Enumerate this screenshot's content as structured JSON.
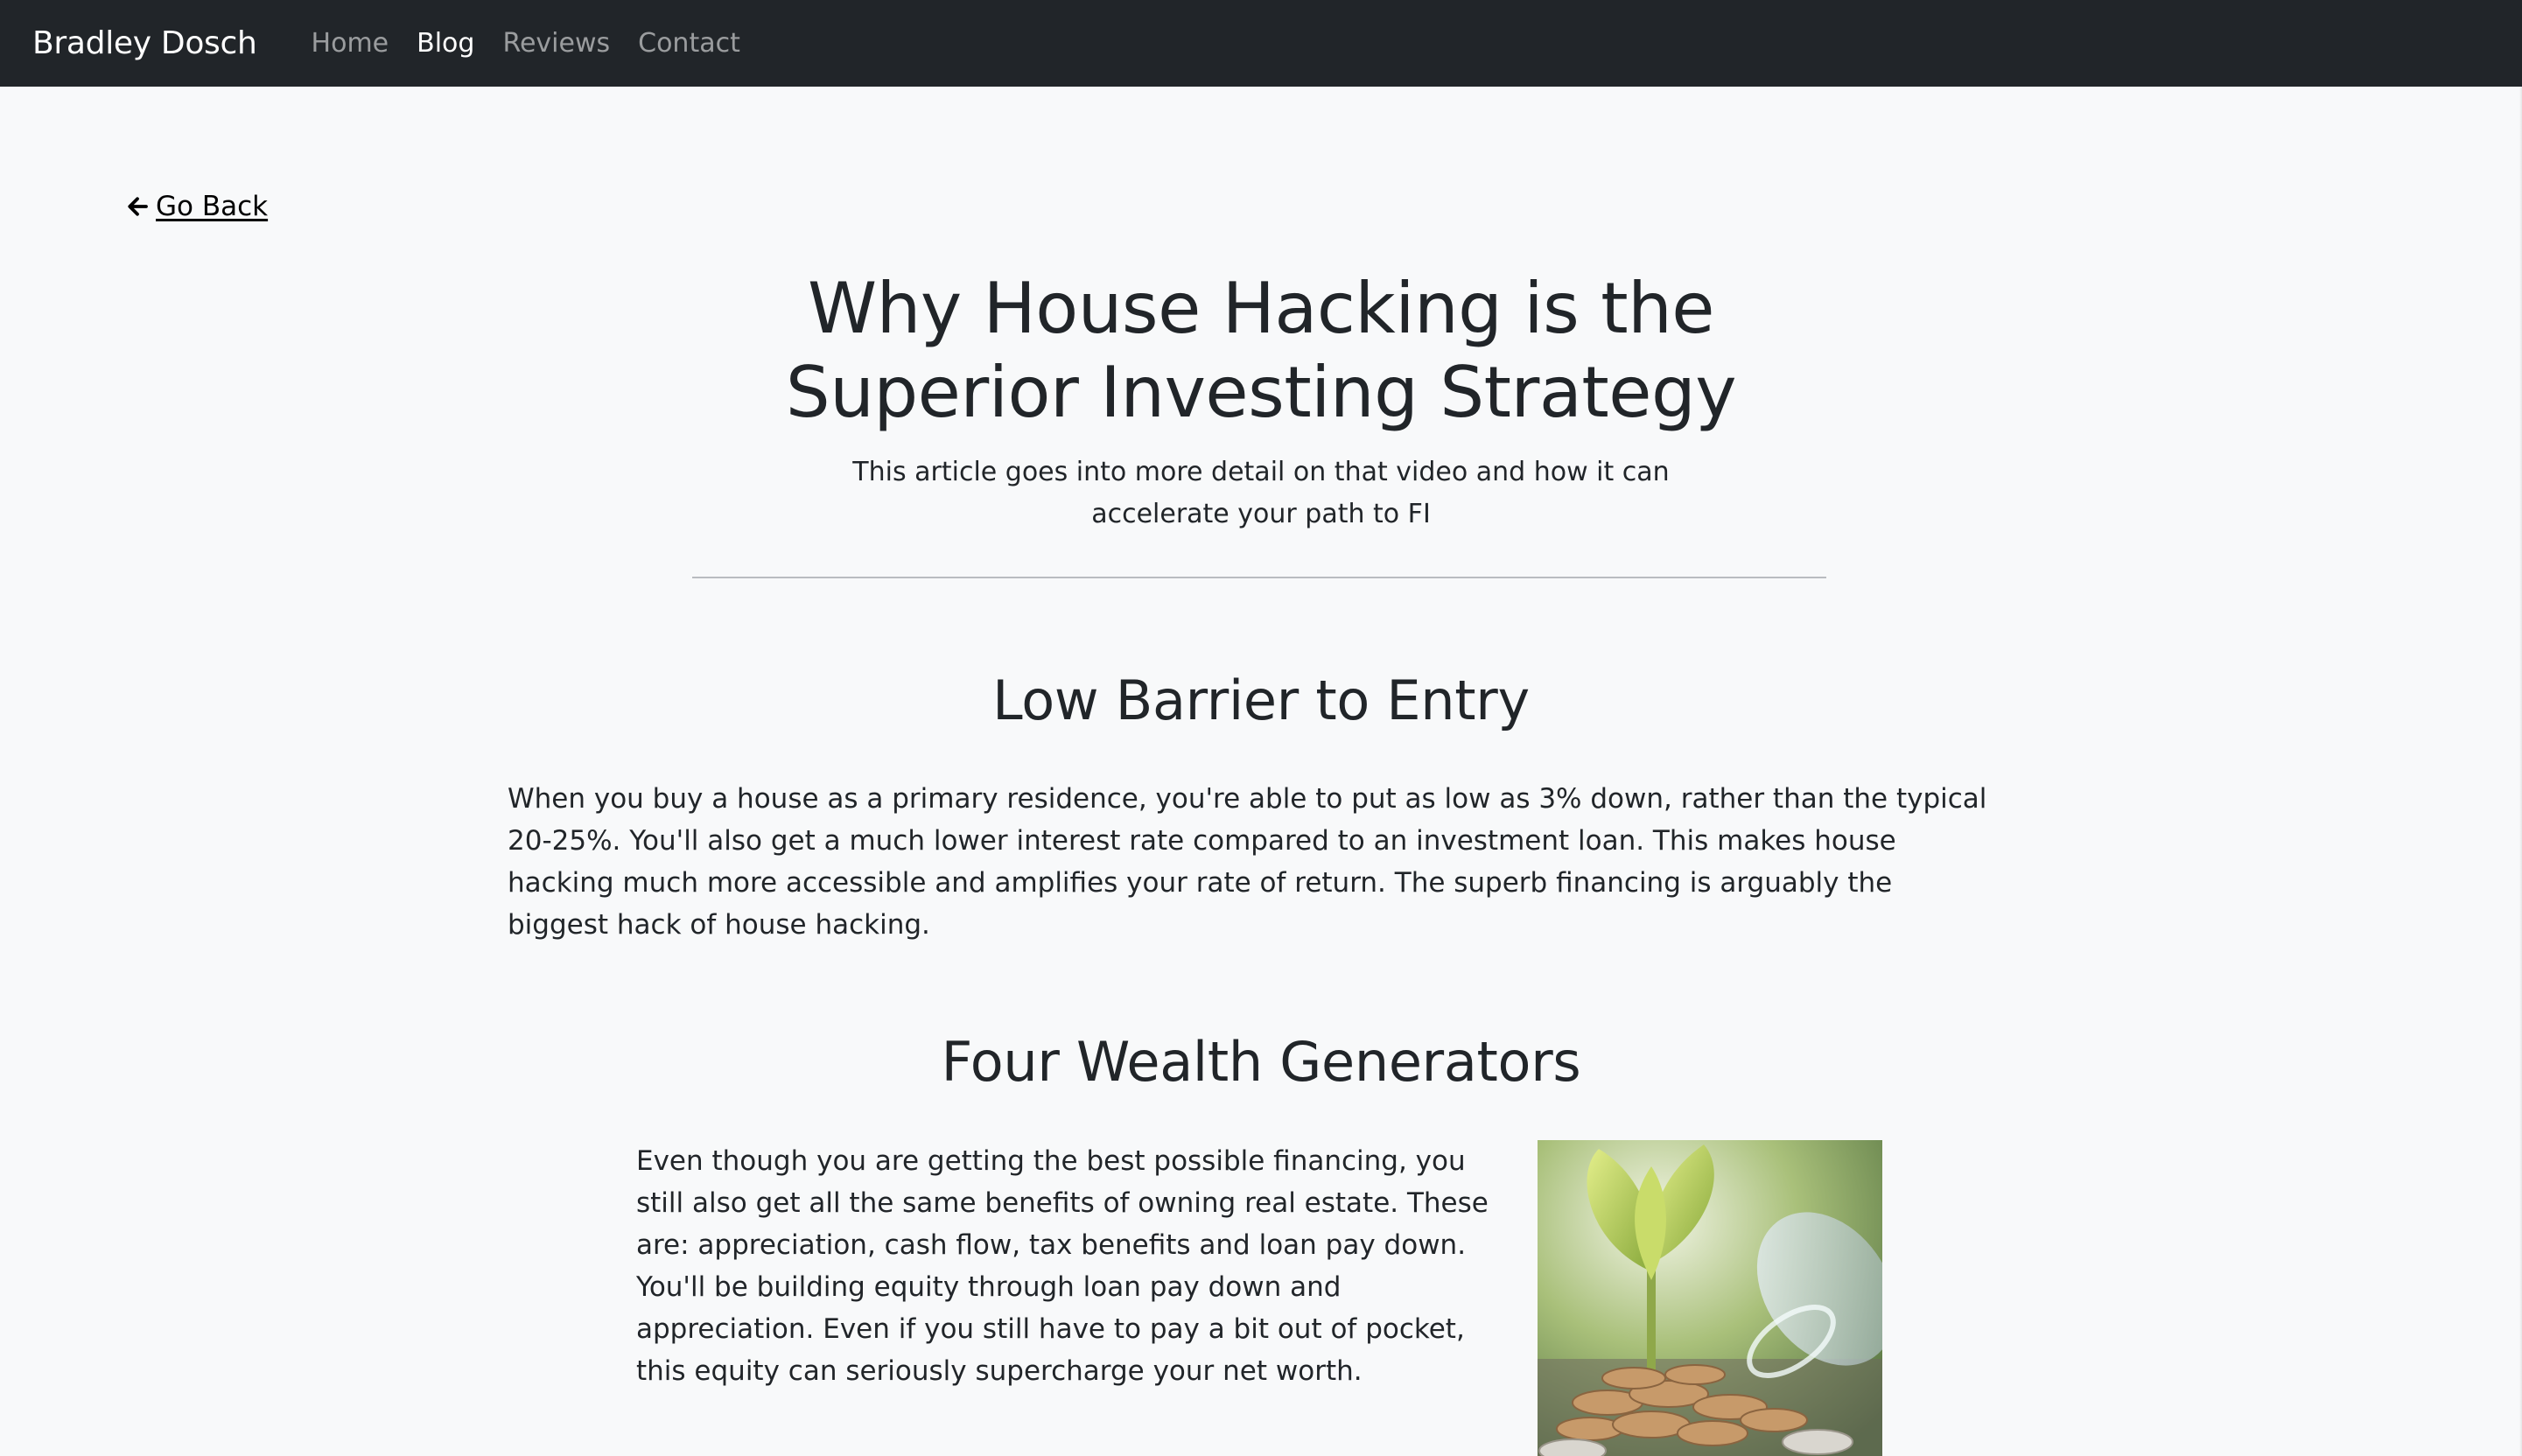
{
  "nav": {
    "brand": "Bradley Dosch",
    "links": [
      {
        "label": "Home",
        "active": false
      },
      {
        "label": "Blog",
        "active": true
      },
      {
        "label": "Reviews",
        "active": false
      },
      {
        "label": "Contact",
        "active": false
      }
    ]
  },
  "goback": {
    "icon": "arrow-left-icon",
    "label": "Go Back"
  },
  "article": {
    "title": "Why House Hacking is the Superior Investing Strategy",
    "subtitle": "This article goes into more detail on that video and how it can accelerate your path to FI",
    "sections": [
      {
        "heading": "Low Barrier to Entry",
        "body": "When you buy a house as a primary residence, you're able to put as low as 3% down, rather than the typical 20-25%. You'll also get a much lower interest rate compared to an investment loan. This makes house hacking much more accessible and amplifies your rate of return. The superb financing is arguably the biggest hack of house hacking."
      },
      {
        "heading": "Four Wealth Generators",
        "body": "Even though you are getting the best possible financing, you still also get all the same benefits of owning real estate. These are: appreciation, cash flow, tax benefits and loan pay down. You'll be building equity through loan pay down and appreciation. Even if you still have to pay a bit out of pocket, this equity can seriously supercharge your net worth."
      }
    ]
  },
  "colors": {
    "navbar_bg": "#212529",
    "page_bg": "#f8f9fa",
    "text": "#212529",
    "nav_inactive": "rgba(255,255,255,0.55)",
    "nav_active": "#ffffff"
  }
}
